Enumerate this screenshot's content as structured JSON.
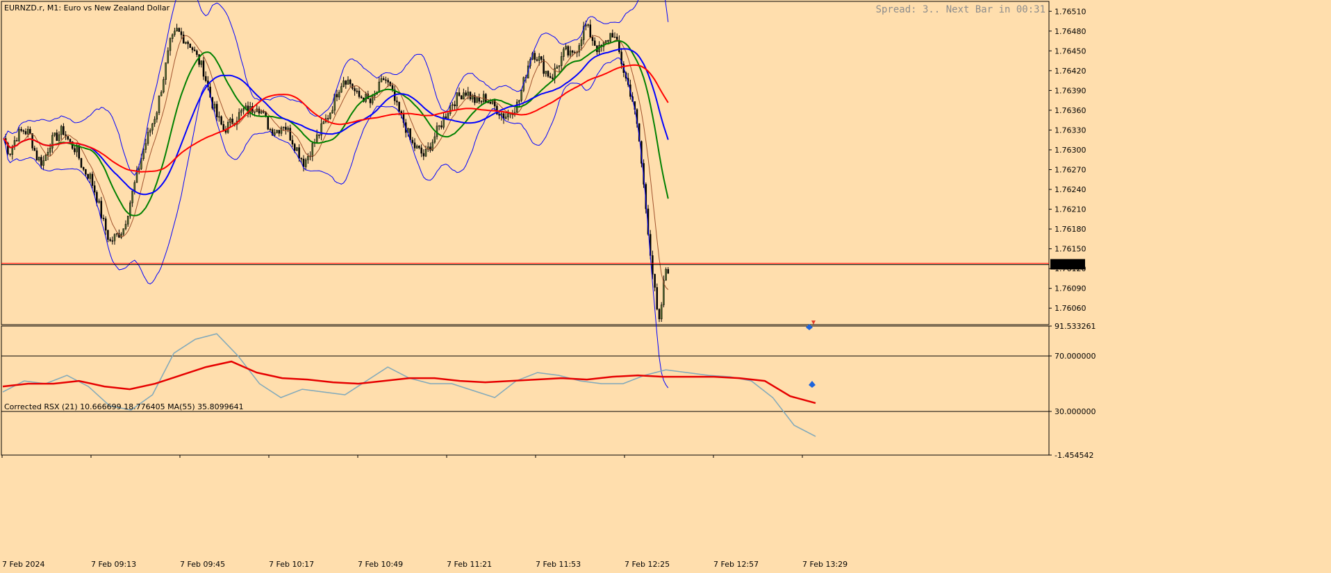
{
  "window": {
    "title": "EURNZD.r, M1:  Euro vs New Zealand Dollar",
    "spread_text": "Spread: 3.. Next Bar in 00:31"
  },
  "colors": {
    "background": "#ffdead",
    "bull_candle": "#556b2f",
    "bear_candle": "#000000",
    "ma_fast": "#a0522d",
    "ma_green": "#008000",
    "ma_blue": "#0000ff",
    "ma_red": "#ff0000",
    "bands": "#0000ff",
    "price_line": "#ff0000",
    "rsx_up": "#1eb4e6",
    "rsx_down": "#f4a08c",
    "rsx_ma": "#e60000"
  },
  "price_axis": {
    "ticks": [
      "1.76510",
      "1.76480",
      "1.76450",
      "1.76420",
      "1.76390",
      "1.76360",
      "1.76330",
      "1.76300",
      "1.76270",
      "1.76240",
      "1.76210",
      "1.76180",
      "1.76150",
      "1.76120",
      "1.76090",
      "1.76060"
    ],
    "current_price_label": "1.76126"
  },
  "time_axis": {
    "labels": [
      "7 Feb 2024",
      "7 Feb 09:13",
      "7 Feb 09:45",
      "7 Feb 10:17",
      "7 Feb 10:49",
      "7 Feb 11:21",
      "7 Feb 11:53",
      "7 Feb 12:25",
      "7 Feb 12:57",
      "7 Feb 13:29"
    ]
  },
  "indicator": {
    "title": "Corrected RSX (21) 10.666699 18.776405 MA(55) 35.8099641",
    "axis_labels": [
      "91.533261",
      "70.000000",
      "30.000000",
      "-1.454542"
    ],
    "levels": [
      70,
      30
    ]
  },
  "chart_data": [
    {
      "type": "line",
      "title": "EURNZD.r, M1:  Euro vs New Zealand Dollar",
      "x_labels": [
        "7 Feb 2024",
        "7 Feb 09:13",
        "7 Feb 09:45",
        "7 Feb 10:17",
        "7 Feb 10:49",
        "7 Feb 11:21",
        "7 Feb 11:53",
        "7 Feb 12:25",
        "7 Feb 12:57",
        "7 Feb 13:29"
      ],
      "ylim": [
        1.76035,
        1.76525
      ],
      "close_approx": [
        1.7632,
        1.76295,
        1.7632,
        1.7633,
        1.76325,
        1.7629,
        1.7628,
        1.7631,
        1.7632,
        1.7633,
        1.7631,
        1.763,
        1.7627,
        1.7626,
        1.7623,
        1.7619,
        1.7616,
        1.7617,
        1.7618,
        1.7622,
        1.7626,
        1.763,
        1.7633,
        1.7636,
        1.7641,
        1.7646,
        1.7648,
        1.7647,
        1.7646,
        1.7644,
        1.7642,
        1.7638,
        1.7635,
        1.7633,
        1.7634,
        1.7635,
        1.7636,
        1.7636,
        1.7637,
        1.7635,
        1.7633,
        1.7633,
        1.7634,
        1.7632,
        1.763,
        1.7628,
        1.763,
        1.7632,
        1.7634,
        1.7636,
        1.7639,
        1.7641,
        1.764,
        1.7638,
        1.7638,
        1.7637,
        1.7639,
        1.7641,
        1.7639,
        1.7636,
        1.7634,
        1.7631,
        1.763,
        1.7629,
        1.7631,
        1.7633,
        1.7635,
        1.7637,
        1.7638,
        1.7639,
        1.7638,
        1.7637,
        1.7638,
        1.7637,
        1.7636,
        1.7635,
        1.7636,
        1.7637,
        1.7641,
        1.7645,
        1.7644,
        1.7642,
        1.7641,
        1.7643,
        1.7645,
        1.7644,
        1.7646,
        1.7649,
        1.7647,
        1.7645,
        1.7646,
        1.7648,
        1.7645,
        1.7641,
        1.7638,
        1.7632,
        1.7622,
        1.7612,
        1.7603,
        1.7612
      ],
      "series": [
        {
          "name": "MA(55)",
          "values": [
            1.7633,
            1.7632,
            1.7631,
            1.763,
            1.763,
            1.7631,
            1.7632,
            1.7633,
            1.7633,
            1.7633,
            1.7634,
            1.7635,
            1.7636,
            1.7637,
            1.7638,
            1.7638,
            1.7639,
            1.7639,
            1.7638,
            1.7636
          ]
        }
      ]
    },
    {
      "type": "line",
      "title": "Corrected RSX (21) 10.666699 18.776405 MA(55) 35.8099641",
      "ylim": [
        -1.454542,
        91.533261
      ],
      "levels": [
        70,
        30
      ],
      "series": [
        {
          "name": "Corrected RSX (21)",
          "values": [
            44,
            52,
            50,
            56,
            48,
            34,
            31,
            42,
            72,
            82,
            86,
            70,
            50,
            40,
            46,
            44,
            42,
            52,
            62,
            54,
            50,
            50,
            45,
            40,
            52,
            58,
            56,
            52,
            50,
            50,
            56,
            60,
            58,
            56,
            55,
            52,
            40,
            20,
            12
          ]
        },
        {
          "name": "MA(55)",
          "values": [
            48,
            50,
            50,
            52,
            48,
            46,
            50,
            56,
            62,
            66,
            58,
            54,
            53,
            51,
            50,
            52,
            54,
            54,
            52,
            51,
            52,
            53,
            54,
            53,
            55,
            56,
            55,
            55,
            55,
            54,
            52,
            41,
            36
          ]
        }
      ]
    }
  ]
}
